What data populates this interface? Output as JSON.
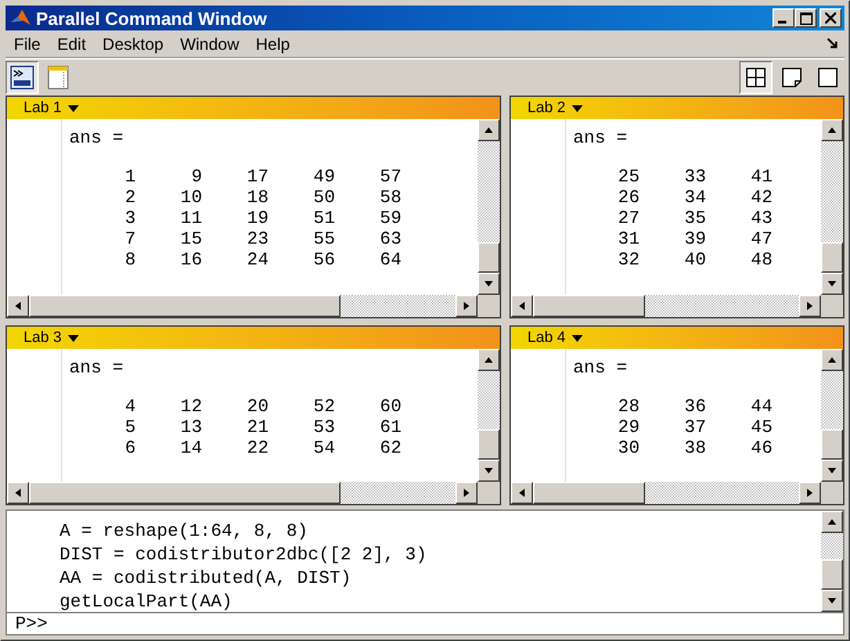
{
  "window": {
    "title": "Parallel Command Window"
  },
  "menu": [
    "File",
    "Edit",
    "Desktop",
    "Window",
    "Help"
  ],
  "toolbar": {
    "tools": [
      {
        "kind": "command",
        "selected": true
      },
      {
        "kind": "notes",
        "selected": false
      }
    ],
    "layouts": [
      {
        "kind": "grid",
        "selected": true
      },
      {
        "kind": "float",
        "selected": false
      },
      {
        "kind": "single",
        "selected": false
      }
    ]
  },
  "labs": [
    {
      "title": "Lab 1",
      "output": "ans =",
      "rows": [
        [
          "1",
          "9",
          "17",
          "49",
          "57"
        ],
        [
          "2",
          "10",
          "18",
          "50",
          "58"
        ],
        [
          "3",
          "11",
          "19",
          "51",
          "59"
        ],
        [
          "7",
          "15",
          "23",
          "55",
          "63"
        ],
        [
          "8",
          "16",
          "24",
          "56",
          "64"
        ]
      ]
    },
    {
      "title": "Lab 2",
      "output": "ans =",
      "rows": [
        [
          "25",
          "33",
          "41"
        ],
        [
          "26",
          "34",
          "42"
        ],
        [
          "27",
          "35",
          "43"
        ],
        [
          "31",
          "39",
          "47"
        ],
        [
          "32",
          "40",
          "48"
        ]
      ]
    },
    {
      "title": "Lab 3",
      "output": "ans =",
      "rows": [
        [
          "4",
          "12",
          "20",
          "52",
          "60"
        ],
        [
          "5",
          "13",
          "21",
          "53",
          "61"
        ],
        [
          "6",
          "14",
          "22",
          "54",
          "62"
        ]
      ]
    },
    {
      "title": "Lab 4",
      "output": "ans =",
      "rows": [
        [
          "28",
          "36",
          "44"
        ],
        [
          "29",
          "37",
          "45"
        ],
        [
          "30",
          "38",
          "46"
        ]
      ]
    }
  ],
  "command_history": [
    "A = reshape(1:64, 8, 8)",
    "DIST = codistributor2dbc([2 2], 3)",
    "AA = codistributed(A, DIST)",
    "getLocalPart(AA)"
  ],
  "prompt": "P>>"
}
